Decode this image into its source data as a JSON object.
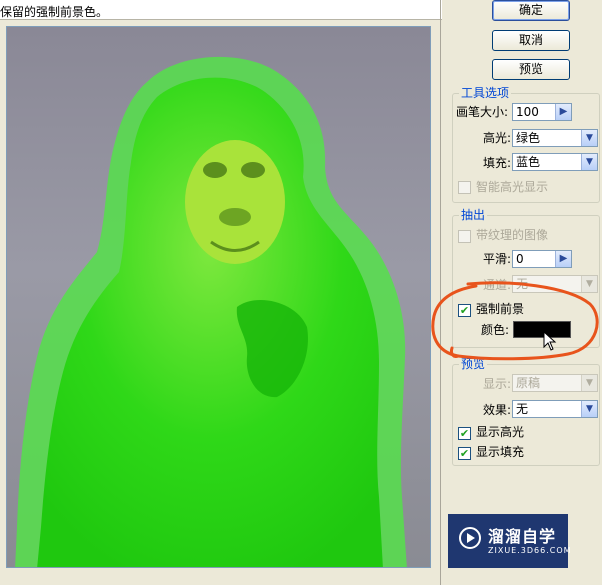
{
  "hint_text": "保留的强制前景色。",
  "buttons": {
    "ok": "确定",
    "cancel": "取消",
    "preview": "预览"
  },
  "tool_options": {
    "title": "工具选项",
    "brush_size_label": "画笔大小:",
    "brush_size_value": "100",
    "highlight_label": "高光:",
    "highlight_value": "绿色",
    "fill_label": "填充:",
    "fill_value": "蓝色",
    "smart_highlight_label": "智能高光显示",
    "smart_highlight_checked": false
  },
  "extract": {
    "title": "抽出",
    "textured_image_label": "带纹理的图像",
    "textured_image_checked": false,
    "smooth_label": "平滑:",
    "smooth_value": "0",
    "channel_label": "通道:",
    "channel_value": "无",
    "force_foreground_label": "强制前景",
    "force_foreground_checked": true,
    "color_label": "颜色:",
    "color_value": "#000000"
  },
  "preview_group": {
    "title": "预览",
    "show_label": "显示:",
    "show_value": "原稿",
    "effect_label": "效果:",
    "effect_value": "无",
    "show_highlight_label": "显示高光",
    "show_highlight_checked": true,
    "show_fill_label": "显示填充",
    "show_fill_checked": true
  },
  "watermark": {
    "title": "溜溜自学",
    "subtitle": "ZIXUE.3D66.COM"
  },
  "colors": {
    "highlight_green": "#2ed81a",
    "annotation_orange": "#e8541c",
    "group_title_blue": "#0046d5"
  },
  "icons": {
    "spin": "chevron-right-icon",
    "dropdown": "chevron-down-icon",
    "cursor": "mouse-pointer-icon",
    "watermark": "play-circle-icon"
  }
}
